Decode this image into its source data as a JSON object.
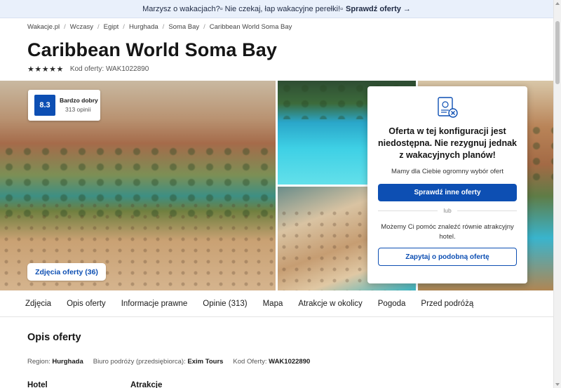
{
  "promo": {
    "text": "Marzysz o wakacjach?▫ Nie czekaj, łap wakacyjne perełki!▫",
    "cta": "Sprawdź oferty →"
  },
  "breadcrumb": [
    "Wakacje.pl",
    "Wczasy",
    "Egipt",
    "Hurghada",
    "Soma Bay",
    "Caribbean World Soma Bay"
  ],
  "hotel": {
    "name": "Caribbean World Soma Bay",
    "stars": "★★★★★",
    "code_text": "Kod oferty: WAK1022890"
  },
  "rating": {
    "score": "8.3",
    "label": "Bardzo dobry",
    "count": "313 opinii"
  },
  "photos_button": "Zdjęcia oferty (36)",
  "modal": {
    "title": "Oferta w tej konfiguracji jest niedostępna. Nie rezygnuj jednak z wakacyjnych planów!",
    "subtitle": "Mamy dla Ciebie ogromny wybór ofert",
    "primary_button": "Sprawdź inne oferty",
    "or": "lub",
    "help_text": "Możemy Ci pomóc znaleźć równie atrakcyjny hotel.",
    "secondary_button": "Zapytaj o podobną ofertę"
  },
  "tabs": [
    "Zdjęcia",
    "Opis oferty",
    "Informacje prawne",
    "Opinie (313)",
    "Mapa",
    "Atrakcje w okolicy",
    "Pogoda",
    "Przed podróżą"
  ],
  "description": {
    "title": "Opis oferty",
    "region_label": "Region:",
    "region_value": "Hurghada",
    "operator_label": "Biuro podróży (przedsiębiorca):",
    "operator_value": "Exim Tours",
    "code_label": "Kod Oferty:",
    "code_value": "WAK1022890",
    "hotel_heading": "Hotel",
    "attractions_heading": "Atrakcje"
  },
  "colors": {
    "brand_blue": "#0d4fb3",
    "promo_bg": "#e9f0fb"
  }
}
